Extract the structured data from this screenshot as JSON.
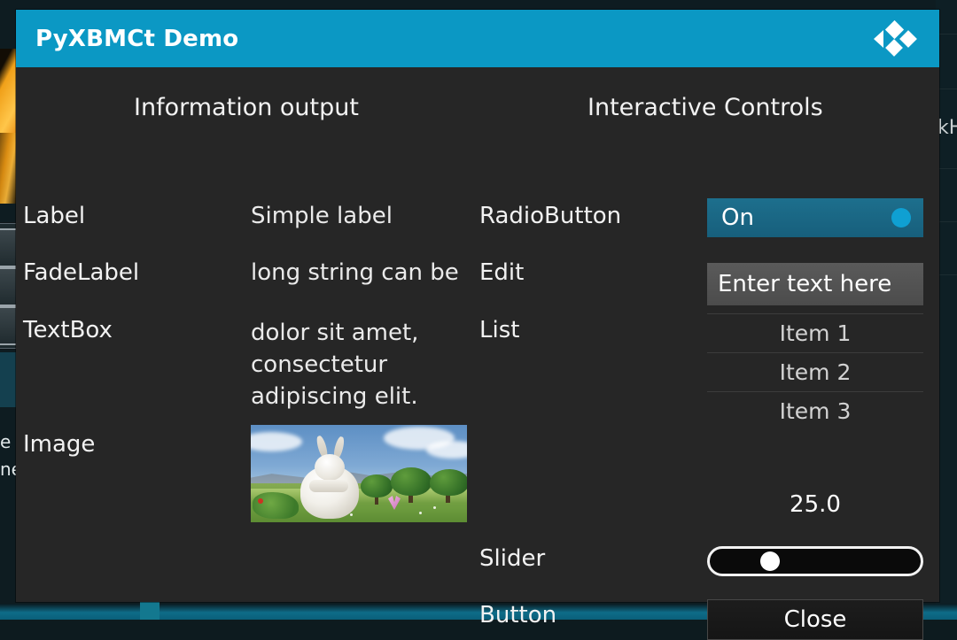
{
  "background": {
    "right_text": "kH",
    "left_text_line1": "e",
    "left_text_line2": "ne"
  },
  "dialog": {
    "title": "PyXBMCt Demo",
    "logo_icon": "kodi-logo-icon",
    "header_color": "#0b98c4",
    "body_color": "#262626"
  },
  "headings": {
    "left": "Information output",
    "right": "Interactive Controls"
  },
  "info_rows": [
    {
      "label": "Label",
      "value": "Simple label"
    },
    {
      "label": "FadeLabel",
      "value": "long string can be"
    },
    {
      "label": "TextBox",
      "value": "dolor sit amet,\nconsectetur\nadipiscing elit."
    },
    {
      "label": "Image",
      "value": ""
    }
  ],
  "labels": {
    "label": "Label",
    "fadelabel": "FadeLabel",
    "textbox": "TextBox",
    "image": "Image",
    "radiobutton": "RadioButton",
    "edit": "Edit",
    "list": "List",
    "slider": "Slider",
    "button": "Button"
  },
  "values": {
    "label": "Simple label",
    "fadelabel": "long string can be",
    "textbox": "dolor sit amet,\nconsectetur\nadipiscing elit."
  },
  "controls": {
    "radio": {
      "state_label": "On",
      "checked": true,
      "bg_color": "#1d6f8d",
      "indicator_color": "#0fa0d2"
    },
    "edit": {
      "value": "Enter text here",
      "placeholder": "Enter text here",
      "bg_color": "#545454"
    },
    "list": {
      "items": [
        "Item 1",
        "Item 2",
        "Item 3"
      ]
    },
    "slider": {
      "value_label": "25.0",
      "value": 25.0,
      "min": 0,
      "max": 100
    },
    "button": {
      "label": "Close"
    }
  }
}
